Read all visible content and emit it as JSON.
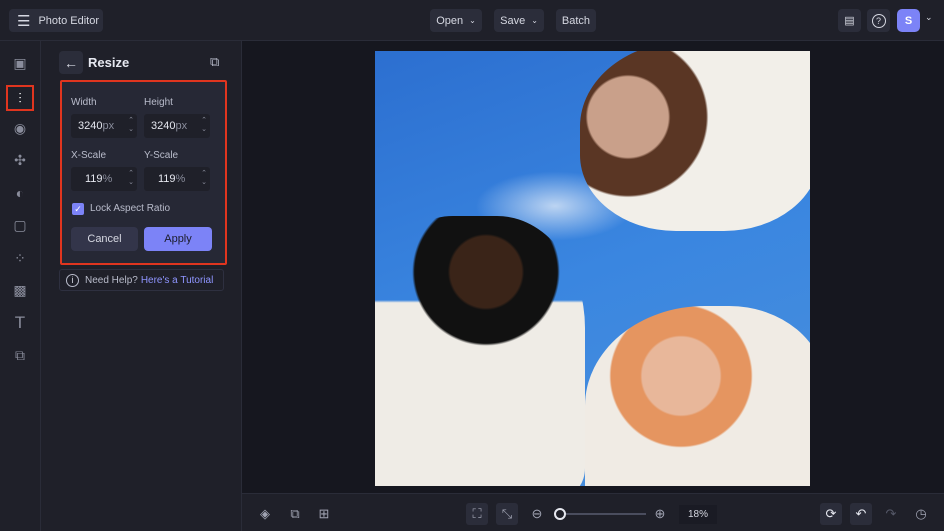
{
  "header": {
    "app_title": "Photo Editor",
    "open": "Open",
    "save": "Save",
    "batch": "Batch",
    "avatar": "S"
  },
  "panel": {
    "title": "Resize",
    "width_label": "Width",
    "height_label": "Height",
    "width_value": "3240",
    "height_value": "3240",
    "px_unit": "px",
    "xscale_label": "X-Scale",
    "yscale_label": "Y-Scale",
    "xscale_value": "119",
    "yscale_value": "119",
    "pct_unit": "%",
    "lock_label": "Lock Aspect Ratio",
    "lock_checked": true,
    "cancel": "Cancel",
    "apply": "Apply",
    "help_text": "Need Help?",
    "help_link": "Here's a Tutorial"
  },
  "bottom": {
    "zoom_value": "18%",
    "zoom_fraction": 0.02
  },
  "colors": {
    "accent": "#7c83f7",
    "highlight": "#e0351f"
  }
}
